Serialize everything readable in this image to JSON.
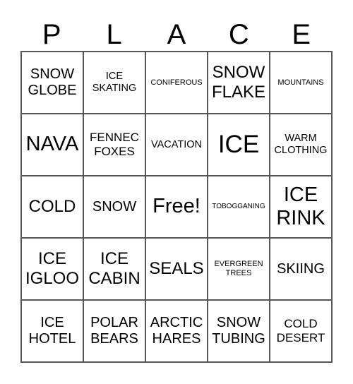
{
  "header": {
    "letters": [
      "P",
      "L",
      "A",
      "C",
      "E"
    ]
  },
  "cells": [
    [
      "SNOW GLOBE",
      "ICE SKATING",
      "CONIFEROUS",
      "SNOW FLAKE",
      "MOUNTAINS"
    ],
    [
      "NAVA",
      "FENNEC FOXES",
      "VACATION",
      "ICE",
      "WARM CLOTHING"
    ],
    [
      "COLD",
      "SNOW",
      "Free!",
      "TOBOGGANING",
      "ICE RINK"
    ],
    [
      "ICE IGLOO",
      "ICE CABIN",
      "SEALS",
      "EVERGREEN TREES",
      "SKIING"
    ],
    [
      "ICE HOTEL",
      "POLAR BEARS",
      "ARCTIC HARES",
      "SNOW TUBING",
      "COLD DESERT"
    ]
  ]
}
